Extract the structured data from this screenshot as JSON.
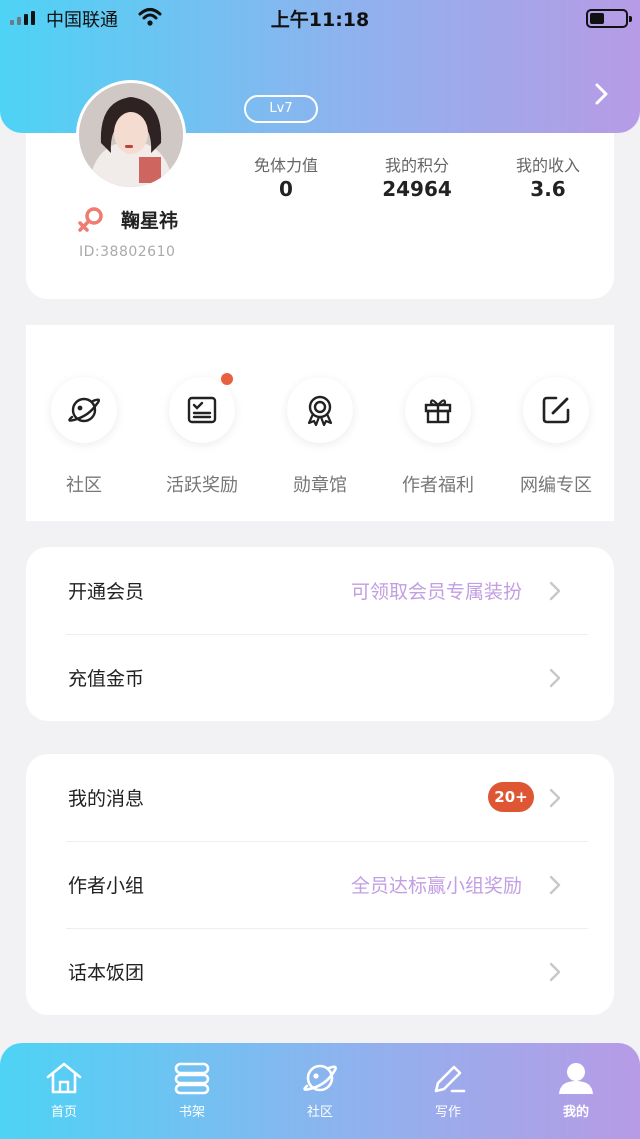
{
  "status_bar": {
    "carrier": "中国联通",
    "time": "上午11:18"
  },
  "profile": {
    "level": "Lv7",
    "username": "鞠星祎",
    "user_id": "ID:38802610",
    "gender_icon": "female-icon",
    "stats": [
      {
        "label": "免体力值",
        "value": "0"
      },
      {
        "label": "我的积分",
        "value": "24964"
      },
      {
        "label": "我的收入",
        "value": "3.6"
      }
    ]
  },
  "quick_links": [
    {
      "label": "社区",
      "icon": "planet-icon",
      "dot": false
    },
    {
      "label": "活跃奖励",
      "icon": "checklist-icon",
      "dot": true
    },
    {
      "label": "勋章馆",
      "icon": "medal-icon",
      "dot": false
    },
    {
      "label": "作者福利",
      "icon": "gift-icon",
      "dot": false
    },
    {
      "label": "网编专区",
      "icon": "edit-icon",
      "dot": false
    }
  ],
  "menu_group_1": [
    {
      "label": "开通会员",
      "hint": "可领取会员专属装扮"
    },
    {
      "label": "充值金币",
      "hint": ""
    }
  ],
  "menu_group_2": [
    {
      "label": "我的消息",
      "badge": "20+"
    },
    {
      "label": "作者小组",
      "hint": "全员达标赢小组奖励"
    },
    {
      "label": "话本饭团",
      "hint": ""
    }
  ],
  "tab_bar": [
    {
      "label": "首页",
      "icon": "home-icon"
    },
    {
      "label": "书架",
      "icon": "bookshelf-icon"
    },
    {
      "label": "社区",
      "icon": "planet-icon"
    },
    {
      "label": "写作",
      "icon": "pencil-icon"
    },
    {
      "label": "我的",
      "icon": "user-icon",
      "active": true
    }
  ],
  "colors": {
    "gradient_start": "#4dd3f5",
    "gradient_end": "#b79be6",
    "hint_purple": "#c29ee3",
    "badge_red": "#de5634"
  }
}
